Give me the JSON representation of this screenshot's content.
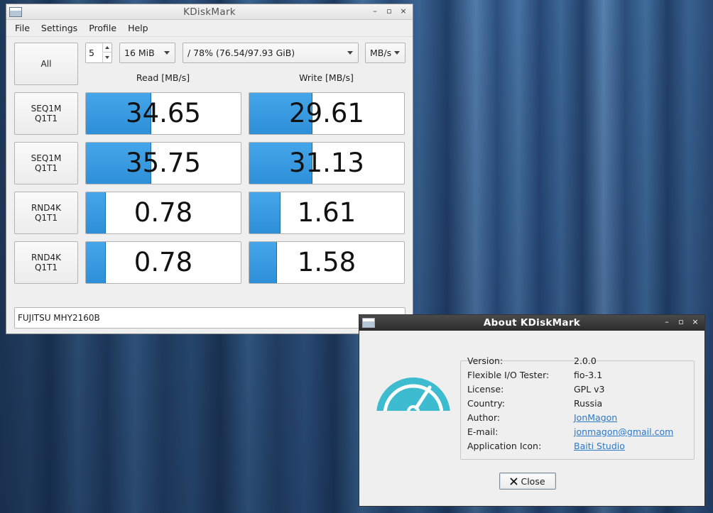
{
  "main_window": {
    "title": "KDiskMark",
    "menu": [
      "File",
      "Settings",
      "Profile",
      "Help"
    ],
    "all_button": "All",
    "loops": "5",
    "file_size": "16 MiB",
    "target": "/ 78% (76.54/97.93 GiB)",
    "unit": "MB/s",
    "read_header": "Read [MB/s]",
    "write_header": "Write [MB/s]",
    "rows": [
      {
        "label1": "SEQ1M",
        "label2": "Q1T1",
        "read": "34.65",
        "read_fill": 0.42,
        "write": "29.61",
        "write_fill": 0.41
      },
      {
        "label1": "SEQ1M",
        "label2": "Q1T1",
        "read": "35.75",
        "read_fill": 0.42,
        "write": "31.13",
        "write_fill": 0.41
      },
      {
        "label1": "RND4K",
        "label2": "Q1T1",
        "read": "0.78",
        "read_fill": 0.13,
        "write": "1.61",
        "write_fill": 0.2
      },
      {
        "label1": "RND4K",
        "label2": "Q1T1",
        "read": "0.78",
        "read_fill": 0.13,
        "write": "1.58",
        "write_fill": 0.18
      }
    ],
    "drive": "FUJITSU MHY2160B",
    "window_controls": [
      "–",
      "▫",
      "×"
    ]
  },
  "about_dialog": {
    "title": "About KDiskMark",
    "window_controls": [
      "–",
      "▫",
      "×"
    ],
    "fields": [
      {
        "label": "Version:",
        "value": "2.0.0",
        "link": false
      },
      {
        "label": "Flexible I/O Tester:",
        "value": "fio-3.1",
        "link": false
      },
      {
        "label": "License:",
        "value": "GPL v3",
        "link": false
      },
      {
        "label": "Country:",
        "value": "Russia",
        "link": false
      },
      {
        "label": "Author:",
        "value": "JonMagon",
        "link": true
      },
      {
        "label": "E-mail:",
        "value": "jonmagon@gmail.com",
        "link": true
      },
      {
        "label": "Application Icon:",
        "value": "Baiti Studio",
        "link": true
      }
    ],
    "close_label": "Close",
    "close_icon": "close-icon",
    "gauge_icon": "speedometer-icon",
    "gauge_color": "#3dbcd0"
  },
  "colors": {
    "meter_fill": "#3a9be2",
    "link": "#2a78c8"
  }
}
